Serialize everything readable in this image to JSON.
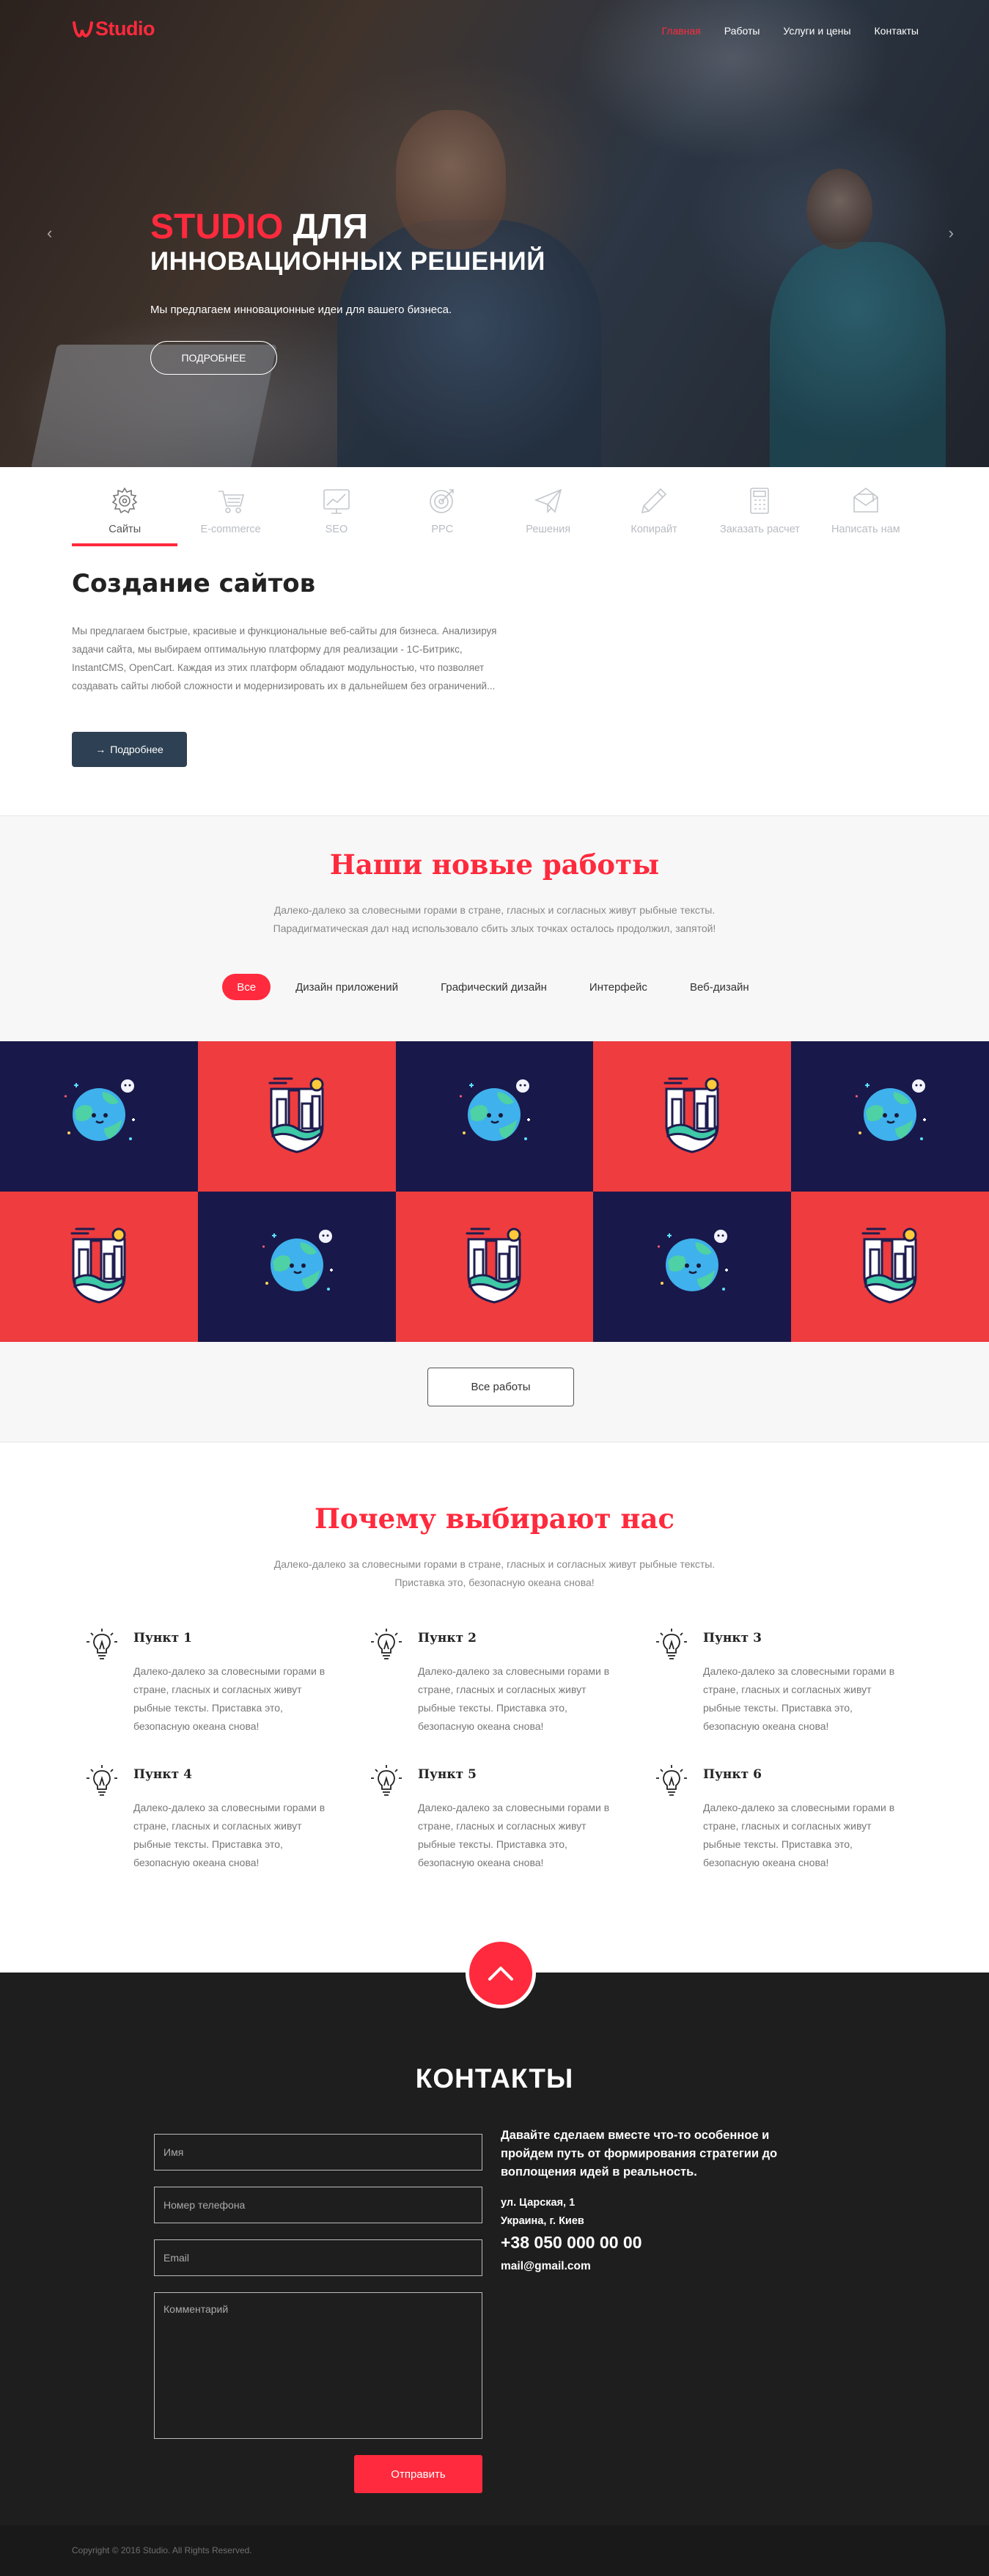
{
  "brand": {
    "logo_text": "Studio",
    "accent": "#ff2a3d"
  },
  "nav": {
    "items": [
      {
        "label": "Главная",
        "active": true
      },
      {
        "label": "Работы"
      },
      {
        "label": "Услуги и цены"
      },
      {
        "label": "Контакты"
      }
    ]
  },
  "hero": {
    "title_accent": "STUDIO",
    "title_rest": " ДЛЯ",
    "title_line2": "ИННОВАЦИОННЫХ РЕШЕНИЙ",
    "subtitle": "Мы предлагаем инновационные идеи для вашего бизнеса.",
    "button": "ПОДРОБНЕЕ",
    "prev_arrow": "‹",
    "next_arrow": "›"
  },
  "services": {
    "tabs": [
      {
        "label": "Сайты",
        "icon": "gear-icon"
      },
      {
        "label": "E-commerce",
        "icon": "cart-icon"
      },
      {
        "label": "SEO",
        "icon": "chart-icon"
      },
      {
        "label": "PPC",
        "icon": "target-icon"
      },
      {
        "label": "Решения",
        "icon": "paper-plane-icon"
      },
      {
        "label": "Копирайт",
        "icon": "pencil-icon"
      },
      {
        "label": "Заказать расчет",
        "icon": "calculator-icon"
      },
      {
        "label": "Написать нам",
        "icon": "envelope-icon"
      }
    ],
    "active_index": 0,
    "title": "Создание сайтов",
    "text": "Мы предлагаем быстрые, красивые и функциональные веб-сайты для бизнеса. Анализируя задачи сайта, мы выбираем оптимальную платформу для реализации - 1С-Битрикс, InstantCMS, OpenCart. Каждая из этих платформ обладают модульностью, что позволяет создавать сайты любой сложности и модернизировать их в дальнейшем без ограничений...",
    "button": "Подробнее",
    "button_arrow": "→"
  },
  "works": {
    "title": "Наши новые работы",
    "subtitle_line1": "Далеко-далеко за словесными горами в стране, гласных и согласных живут рыбные тексты.",
    "subtitle_line2": "Парадигматическая дал над использовало сбить злых точках осталось продолжил, запятой!",
    "filters": [
      "Все",
      "Дизайн приложений",
      "Графический дизайн",
      "Интерфейс",
      "Веб-дизайн"
    ],
    "active_filter": 0,
    "tiles": [
      {
        "bg": "navy",
        "icon": "planet-icon"
      },
      {
        "bg": "red",
        "icon": "city-shield-icon"
      },
      {
        "bg": "navy",
        "icon": "planet-icon"
      },
      {
        "bg": "red",
        "icon": "city-shield-icon"
      },
      {
        "bg": "navy",
        "icon": "planet-icon"
      },
      {
        "bg": "red",
        "icon": "city-shield-icon"
      },
      {
        "bg": "navy",
        "icon": "planet-icon"
      },
      {
        "bg": "red",
        "icon": "city-shield-icon"
      },
      {
        "bg": "navy",
        "icon": "planet-icon"
      },
      {
        "bg": "red",
        "icon": "city-shield-icon"
      }
    ],
    "all_button": "Все работы"
  },
  "why": {
    "title": "Почему выбирают нас",
    "subtitle_line1": "Далеко-далеко за словесными горами в стране, гласных и согласных живут рыбные тексты.",
    "subtitle_line2": "Приставка это, безопасную океана снова!",
    "items": [
      {
        "title": "Пункт 1",
        "text": "Далеко-далеко за словесными горами в стране, гласных и согласных живут рыбные тексты. Приставка это, безопасную океана снова!"
      },
      {
        "title": "Пункт 2",
        "text": "Далеко-далеко за словесными горами в стране, гласных и согласных живут рыбные тексты. Приставка это, безопасную океана снова!"
      },
      {
        "title": "Пункт 3",
        "text": "Далеко-далеко за словесными горами в стране, гласных и согласных живут рыбные тексты. Приставка это, безопасную океана снова!"
      },
      {
        "title": "Пункт 4",
        "text": "Далеко-далеко за словесными горами в стране, гласных и согласных живут рыбные тексты. Приставка это, безопасную океана снова!"
      },
      {
        "title": "Пункт 5",
        "text": "Далеко-далеко за словесными горами в стране, гласных и согласных живут рыбные тексты. Приставка это, безопасную океана снова!"
      },
      {
        "title": "Пункт 6",
        "text": "Далеко-далеко за словесными горами в стране, гласных и согласных живут рыбные тексты. Приставка это, безопасную океана снова!"
      }
    ],
    "icon": "lightbulb-icon"
  },
  "contacts": {
    "title": "КОНТАКТЫ",
    "form": {
      "name_placeholder": "Имя",
      "phone_placeholder": "Номер телефона",
      "email_placeholder": "Email",
      "comment_placeholder": "Комментарий",
      "submit": "Отправить"
    },
    "lead": "Давайте сделаем вместе что-то особенное и пройдем путь от формирования стратегии до воплощения идей в реальность.",
    "address_line1": "ул. Царская, 1",
    "address_line2": "Украина, г. Киев",
    "phone": "+38 050 000 00 00",
    "email": "mail@gmail.com"
  },
  "footer": {
    "copyright": "Copyright © 2016 Studio. All Rights Reserved."
  },
  "colors": {
    "navy_tile": "#19184a",
    "red_tile": "#ee3c3f",
    "dark_bg": "#1e1e1e",
    "button_dark": "#2e4053"
  }
}
